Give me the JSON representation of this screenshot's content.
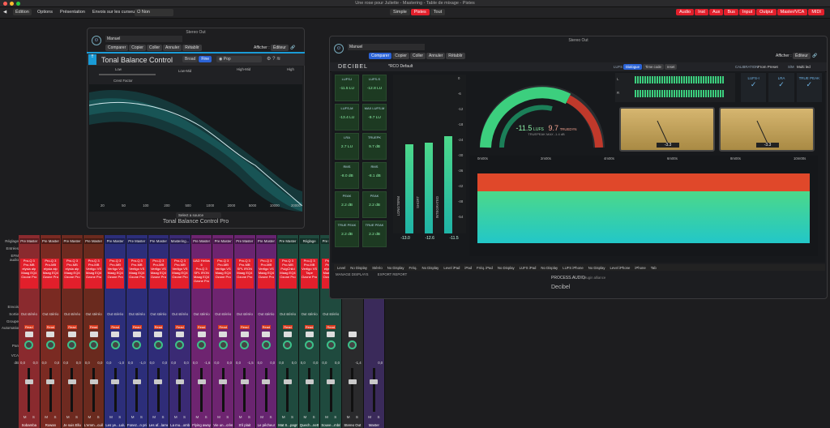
{
  "window": {
    "title": "Une rose pour Juliette - Mastering - Table de mixage - Pistes"
  },
  "toolbar": {
    "edit": "Édition",
    "options": "Options",
    "presentation": "Présentation",
    "send_label": "Envois sur les curseurs :",
    "send_value": "Non",
    "view_tabs": [
      "Simple",
      "Pistes",
      "Tout"
    ],
    "filters": [
      "Audio",
      "Inst",
      "Aux",
      "Bus",
      "Input",
      "Output",
      "Master/VCA",
      "MIDI"
    ]
  },
  "mixer": {
    "row_labels": [
      "Réglage",
      "Entrées",
      "EFM audio",
      "Envois",
      "Sortie",
      "Groupe",
      "Automation",
      "Pan",
      "VCA",
      "dB"
    ],
    "strips": [
      {
        "header": "Pre Master",
        "plugins": [
          "Pro-Q 3",
          "Pro-MB",
          "elysia alp",
          "Maag EQ4",
          "Ozone Pro"
        ],
        "out": "Out stéréo",
        "pan": "0,0",
        "db": "0,0",
        "color": "#8a2a2e",
        "name": "Sobamba"
      },
      {
        "header": "Pre Master",
        "plugins": [
          "Pro-Q 3",
          "Pro-MB",
          "elysia alp",
          "Maag EQ4",
          "Ozone Pro"
        ],
        "out": "Out stéréo",
        "pan": "0,0",
        "db": "0,0",
        "color": "#7a2a22",
        "name": "Rowan"
      },
      {
        "header": "Pre Master",
        "plugins": [
          "Pro-Q 3",
          "Pro-MB",
          "elysia alp",
          "Maag EQ4",
          "Ozone Pro"
        ],
        "out": "Out stéréo",
        "pan": "0,0",
        "db": "0,0",
        "color": "#6e2a20",
        "name": "Je suis Ellu"
      },
      {
        "header": "Pre Master",
        "plugins": [
          "Pro-Q 3",
          "Pro-MB",
          "Vertigo VS",
          "Maag EQ4",
          "Ozone Pro"
        ],
        "out": "Out stéréo",
        "pan": "0,0",
        "db": "0,0",
        "color": "#6a2a1e",
        "name": "L'emm...cuillon"
      },
      {
        "header": "Pre Master",
        "plugins": [
          "Pro-Q 3",
          "Pro-MB",
          "Vertigo VS",
          "Maag EQ4",
          "Ozone Pro"
        ],
        "out": "Out stéréo",
        "pan": "0,0",
        "db": "-1,0",
        "color": "#2c2e7a",
        "name": "Les ye...Lulu"
      },
      {
        "header": "Pre Master",
        "plugins": [
          "Pro-Q 3",
          "Pro-MB",
          "Vertigo VS",
          "Maag EQ4",
          "Ozone Pro"
        ],
        "out": "Out stéréo",
        "pan": "0,0",
        "db": "-1,0",
        "color": "#2c2e7a",
        "name": "Fonez...n prince"
      },
      {
        "header": "Pre Master",
        "plugins": [
          "Pro-Q 3",
          "Pro-MB",
          "Vertigo VS",
          "Maag EQ4",
          "Ozone Pro"
        ],
        "out": "Out stéréo",
        "pan": "0,0",
        "db": "0,0",
        "color": "#2f2c78",
        "name": "Les af...lames"
      },
      {
        "header": "Mastering...",
        "plugins": [
          "Pro-Q 3",
          "Pro-MB",
          "Vertigo VS",
          "Maag EQ4",
          "Ozone Pro"
        ],
        "out": "Out stéréo",
        "pan": "0,0",
        "db": "0,0",
        "color": "#3a2a74",
        "name": "La mu...ombre"
      },
      {
        "header": "Pre Master",
        "plugins": [
          "UAD Helios 6",
          "Pro-Q 3",
          "SPL IRON",
          "Maag EQ4",
          "Ozone Pro"
        ],
        "out": "Out stéréo",
        "pan": "0,0",
        "db": "-1,6",
        "color": "#6e2470",
        "name": "Flying away"
      },
      {
        "header": "Pre Master",
        "plugins": [
          "Pro-Q 3",
          "Pro-MB",
          "Vertigo VS",
          "Maag EQ4",
          "Ozone Pro"
        ],
        "out": "Out stéréo",
        "pan": "0,0",
        "db": "0,0",
        "color": "#6e2470",
        "name": "Vie un...crème"
      },
      {
        "header": "Pre Master",
        "plugins": [
          "Pro-Q 3",
          "Pro-MB",
          "SPL IRON",
          "Maag EQ4",
          "Ozone Pro"
        ],
        "out": "Out stéréo",
        "pan": "0,0",
        "db": "-1,5",
        "color": "#6a2470",
        "name": "S'il plait"
      },
      {
        "header": "Pre Master",
        "plugins": [
          "Pro-Q 3",
          "Pro-MB",
          "Vertigo VS",
          "Maag EQ4",
          "Ozone Pro"
        ],
        "out": "Out stéréo",
        "pan": "0,0",
        "db": "0,0",
        "color": "#662470",
        "name": "Le pêcheur"
      },
      {
        "header": "Pre Master",
        "plugins": [
          "Pro-Q 3",
          "Pro-MB",
          "PuigChild",
          "Maag EQ4",
          "Ozone Pro"
        ],
        "out": "Out stéréo",
        "pan": "0,0",
        "db": "0,0",
        "color": "#1f4a3e",
        "name": "Mat S...pagne"
      },
      {
        "header": "Réglage",
        "plugins": [
          "Pro-Q 3",
          "Pro-MB",
          "Vertigo VS",
          "Tape",
          "Ozone Pro"
        ],
        "out": "Out stéréo",
        "pan": "0,0",
        "db": "0,0",
        "color": "#1f4a3e",
        "name": "Quech...nettes"
      },
      {
        "header": "Pre Master",
        "plugins": [
          "Pro-Q 3",
          "Pro-MB",
          "elysia alp",
          "Maag EQ4",
          "Ozone Pro"
        ],
        "out": "Out stéréo",
        "pan": "0,0",
        "db": "0,0",
        "color": "#1f4a3e",
        "name": "Souve...mbrins"
      },
      {
        "header": "",
        "plugins": [],
        "out": "",
        "pan": "",
        "db": "-1,4",
        "color": "#2a2a2c",
        "name": "Stereo Out"
      },
      {
        "header": "",
        "plugins": [],
        "out": "",
        "pan": "",
        "db": "0,0",
        "color": "#3a2a5a",
        "name": "Master"
      }
    ],
    "read_label": "Read",
    "ms": [
      "M",
      "S"
    ]
  },
  "tbc": {
    "window_title": "Stereo Out",
    "preset": "Manuel",
    "buttons": [
      "Comparer",
      "Copier",
      "Coller",
      "Annuler",
      "Rétablir"
    ],
    "show_label": "Afficher :",
    "show_value": "Éditeur",
    "plugin_title": "Tonal Balance Control",
    "broad": "Broad",
    "fine": "Fine",
    "target": "Pop",
    "bands": [
      "Low",
      "Low-Mid",
      "High-Mid",
      "High"
    ],
    "freq_labels": [
      "20",
      "50",
      "100",
      "200",
      "500",
      "1000",
      "2000",
      "5000",
      "10000",
      "20000"
    ],
    "select_source": "Select a source",
    "footer": "Tonal Balance Control Pro",
    "crest": "Crest Factor"
  },
  "dec": {
    "window_title": "Stereo Out",
    "preset": "Manuel",
    "buttons": [
      "Comparer",
      "Copier",
      "Coller",
      "Annuler",
      "Rétablir"
    ],
    "show_label": "Afficher :",
    "show_value": "Éditeur",
    "brand": "DECIBEL",
    "preset_name": "*RCO Default",
    "luf_label": "LUFS",
    "luf_tabs": [
      "Dialogue",
      "Time code",
      "reset"
    ],
    "calibration_label": "CALIBRATION",
    "calibration_value": "From Preset",
    "sm_label": "S/M",
    "sm_value": "Multi led",
    "cells": [
      {
        "k": "LUFS-I",
        "v": "-11.5 LU"
      },
      {
        "k": "LUFS-S",
        "v": "-12.8 LU"
      },
      {
        "k": "LUFS-M",
        "v": "-13.4 LU"
      },
      {
        "k": "MAX LUFS-M",
        "v": "-9.7 LU"
      },
      {
        "k": "LRA",
        "v": "2.7 LU"
      },
      {
        "k": "TRUEPK",
        "v": "9.7 dB"
      },
      {
        "k": "RMS",
        "v": "-8.0 dB"
      },
      {
        "k": "RMS",
        "v": "-8.1 dB"
      },
      {
        "k": "PEAK",
        "v": "2.2 dB"
      },
      {
        "k": "PEAK",
        "v": "2.2 dB"
      },
      {
        "k": "TRUE PEAK",
        "v": "2.2 dB"
      },
      {
        "k": "TRUE PEAK",
        "v": "2.2 dB"
      }
    ],
    "db_ticks": [
      "0",
      "-6",
      "-12",
      "-18",
      "-24",
      "-30",
      "-36",
      "-42",
      "-48",
      "-54"
    ],
    "bar_values": [
      "-13.0",
      "-12.6",
      "-11.5"
    ],
    "bar_labels": [
      "LONGTERM",
      "SHORT",
      "INTEGRATED"
    ],
    "gauge_lufs": "-11.5",
    "gauge_lufs_label": "LUFS",
    "gauge_truepk": "9.7",
    "gauge_truepk_label": "TRUEDYN",
    "gauge_sub": "TRUEPEAK MAX",
    "gauge_sub_val": "-1.4 dB",
    "lr": [
      "L",
      "R"
    ],
    "status": [
      {
        "k": "LUFS-I"
      },
      {
        "k": "LRA"
      },
      {
        "k": "TRUE PEAK"
      }
    ],
    "vu_values": [
      "-3.3",
      "-3.3"
    ],
    "timeline_ticks": [
      "0m00s",
      "2m00s",
      "4m00s",
      "6m00s",
      "8m00s",
      "10m00s"
    ],
    "bottom_bar": [
      "Level",
      "No Display",
      "Stéréo",
      "No Display",
      "Fréq.",
      "No Display",
      "Level iPad",
      "iPad",
      "Fréq. iPad",
      "No Display",
      "LUFS iPad",
      "No Display",
      "LUFS iPhone",
      "No Display",
      "Level iPhone",
      "iPhone",
      "Tab"
    ],
    "manage": "MANAGE DISPLAYS",
    "export": "EXPORT REPORT",
    "maker": "PROCESS.AUDIO",
    "partner": "plugin alliance",
    "footer": "Decibel"
  }
}
